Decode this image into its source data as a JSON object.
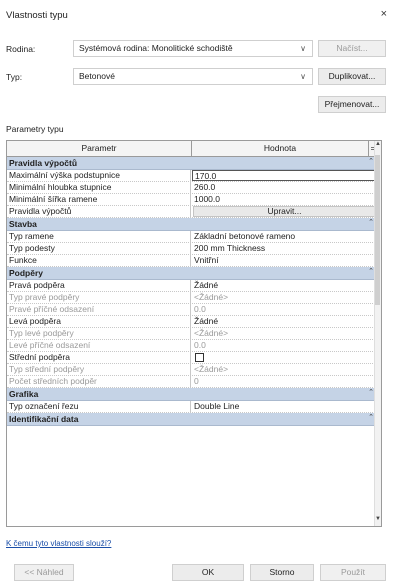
{
  "window": {
    "title": "Vlastnosti typu",
    "close_glyph": "×"
  },
  "family": {
    "label": "Rodina:",
    "value": "Systémová rodina: Monolitické schodiště",
    "load_button": "Načíst..."
  },
  "type": {
    "label": "Typ:",
    "value": "Betonové",
    "duplicate_button": "Duplikovat...",
    "rename_button": "Přejmenovat..."
  },
  "params_caption": "Parametry typu",
  "grid": {
    "header_param": "Parametr",
    "header_value": "Hodnota",
    "header_extra": "=",
    "rows": [
      {
        "kind": "group",
        "label": "Pravidla výpočtů",
        "expander": "⌃"
      },
      {
        "kind": "row",
        "param": "Maximální výška podstupnice",
        "value": "170.0",
        "boxed": true
      },
      {
        "kind": "row",
        "param": "Minimální hloubka stupnice",
        "value": "260.0"
      },
      {
        "kind": "row",
        "param": "Minimální šířka ramene",
        "value": "1000.0"
      },
      {
        "kind": "row",
        "param": "Pravidla výpočtů",
        "button": "Upravit..."
      },
      {
        "kind": "group",
        "label": "Stavba",
        "expander": "⌃"
      },
      {
        "kind": "row",
        "param": "Typ ramene",
        "value": "Základní betonové rameno"
      },
      {
        "kind": "row",
        "param": "Typ podesty",
        "value": "200 mm Thickness"
      },
      {
        "kind": "row",
        "param": "Funkce",
        "value": "Vnitřní"
      },
      {
        "kind": "group",
        "label": "Podpěry",
        "expander": "⌃"
      },
      {
        "kind": "row",
        "param": "Pravá podpěra",
        "value": "Žádné"
      },
      {
        "kind": "row",
        "param": "Typ pravé podpěry",
        "value": "<Žádné>",
        "disabled": true
      },
      {
        "kind": "row",
        "param": "Pravé příčné odsazení",
        "value": "0.0",
        "disabled": true
      },
      {
        "kind": "row",
        "param": "Levá podpěra",
        "value": "Žádné"
      },
      {
        "kind": "row",
        "param": "Typ levé podpěry",
        "value": "<Žádné>",
        "disabled": true
      },
      {
        "kind": "row",
        "param": "Levé příčné odsazení",
        "value": "0.0",
        "disabled": true
      },
      {
        "kind": "row",
        "param": "Střední podpěra",
        "checkbox": true
      },
      {
        "kind": "row",
        "param": "Typ střední podpěry",
        "value": "<Žádné>",
        "disabled": true
      },
      {
        "kind": "row",
        "param": "Počet středních podpěr",
        "value": "0",
        "disabled": true
      },
      {
        "kind": "group",
        "label": "Grafika",
        "expander": "⌃"
      },
      {
        "kind": "row",
        "param": "Typ označení řezu",
        "value": "Double Line"
      },
      {
        "kind": "group",
        "label": "Identifikační data",
        "expander": "⌃"
      }
    ]
  },
  "help_link": "K čemu tyto vlastnosti slouží?",
  "footer": {
    "preview": "<< Náhled",
    "ok": "OK",
    "cancel": "Storno",
    "apply": "Použít"
  }
}
